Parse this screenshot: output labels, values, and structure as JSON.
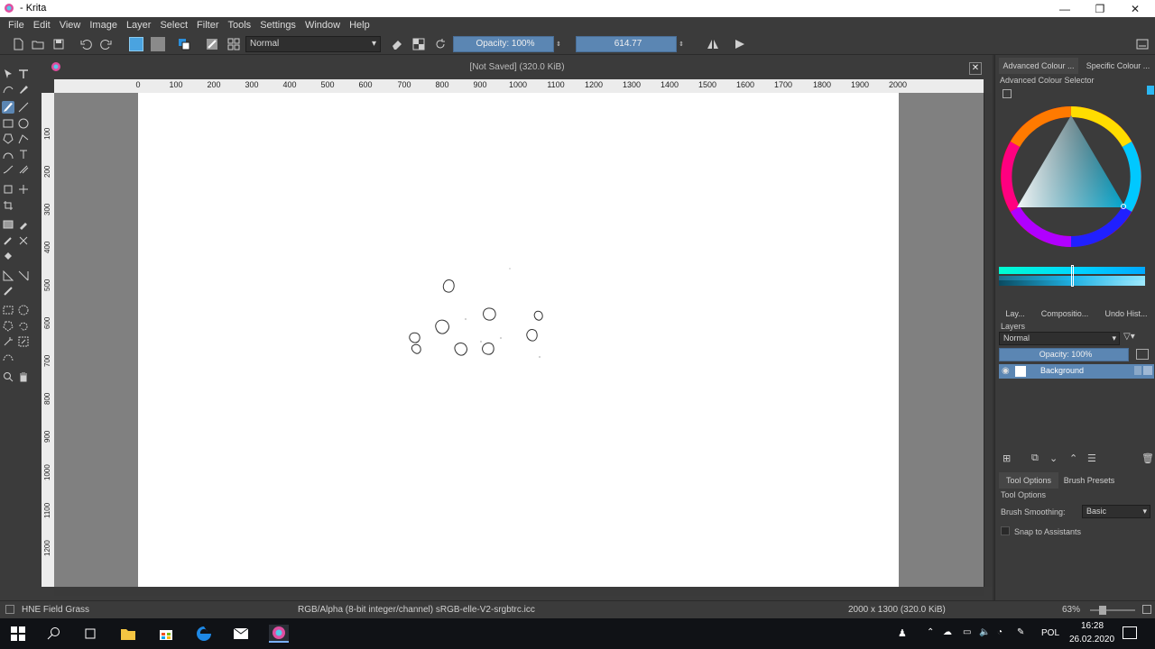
{
  "window": {
    "title": "- Krita",
    "controls": {
      "minimize": "—",
      "maximize": "❐",
      "close": "✕"
    }
  },
  "menu": [
    "File",
    "Edit",
    "View",
    "Image",
    "Layer",
    "Select",
    "Filter",
    "Tools",
    "Settings",
    "Window",
    "Help"
  ],
  "toolbar": {
    "blend_mode": "Normal",
    "opacity": "Opacity: 100%",
    "size": "614.77"
  },
  "document": {
    "title": "[Not Saved]  (320.0 KiB)",
    "ruler_h": [
      "0",
      "100",
      "200",
      "300",
      "400",
      "500",
      "600",
      "700",
      "800",
      "900",
      "1000",
      "1100",
      "1200",
      "1300",
      "1400",
      "1500",
      "1600",
      "1700",
      "1800",
      "1900",
      "2000"
    ],
    "ruler_v": [
      "100",
      "200",
      "300",
      "400",
      "500",
      "600",
      "700",
      "800",
      "900",
      "1000",
      "1100",
      "1200"
    ]
  },
  "dock": {
    "top_tabs": [
      "Advanced Colour ...",
      "Specific Colour ..."
    ],
    "colour_panel_title": "Advanced Colour Selector",
    "mid_tabs": [
      "Lay...",
      "Compositio...",
      "Undo Hist..."
    ],
    "layers_title": "Layers",
    "layers_blend": "Normal",
    "layers_opacity": "Opacity:  100%",
    "layer_name": "Background",
    "bottom_tabs": [
      "Tool Options",
      "Brush Presets"
    ],
    "tool_options_title": "Tool Options",
    "brush_smoothing_label": "Brush Smoothing:",
    "brush_smoothing_value": "Basic",
    "snap_label": "Snap to Assistants"
  },
  "status": {
    "brush": "HNE Field Grass",
    "colorspace": "RGB/Alpha (8-bit integer/channel)  sRGB-elle-V2-srgbtrc.icc",
    "dimensions": "2000 x 1300 (320.0 KiB)",
    "zoom": "63%"
  },
  "taskbar": {
    "lang": "POL",
    "time": "16:28",
    "date": "26.02.2020"
  },
  "colors": {
    "accent": "#5b86b3",
    "canvas_bg": "#808080",
    "panel": "#3b3b3b"
  }
}
